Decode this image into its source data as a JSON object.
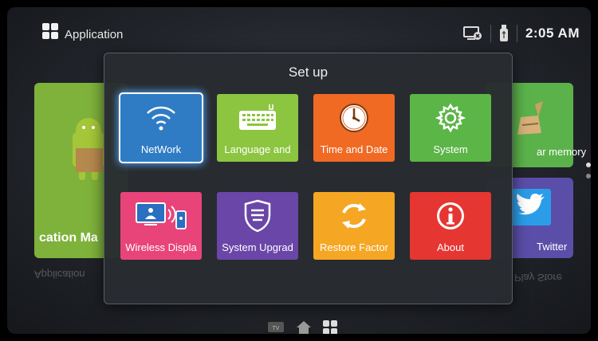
{
  "header": {
    "title": "Application",
    "clock": "2:05 AM",
    "icons": [
      "application-grid-icon",
      "screen-cast-icon",
      "usb-drive-icon"
    ]
  },
  "background": {
    "left_tile_label": "cation Ma",
    "right_top_label": "ar memory",
    "right_bottom_label": "Twitter",
    "reflection_left": "Application",
    "reflection_right": "Play Store"
  },
  "dialog": {
    "title": "Set up",
    "tiles": [
      {
        "label": "NetWork",
        "icon": "wifi-icon",
        "color": "#2f7cc4"
      },
      {
        "label": "Language and",
        "icon": "keyboard-icon",
        "color": "#8cc540"
      },
      {
        "label": "Time and Date",
        "icon": "clock-icon",
        "color": "#f06a24"
      },
      {
        "label": "System",
        "icon": "gear-icon",
        "color": "#5cb547"
      },
      {
        "label": "Wireless Displa",
        "icon": "wireless-display-icon",
        "color": "#e8447a"
      },
      {
        "label": "System Upgrad",
        "icon": "shield-icon",
        "color": "#6a46a8"
      },
      {
        "label": "Restore Factor",
        "icon": "refresh-icon",
        "color": "#f5a623"
      },
      {
        "label": "About",
        "icon": "info-icon",
        "color": "#e53632"
      }
    ]
  },
  "dock": {
    "items": [
      "TV",
      "home-icon",
      "apps-grid-icon"
    ]
  }
}
